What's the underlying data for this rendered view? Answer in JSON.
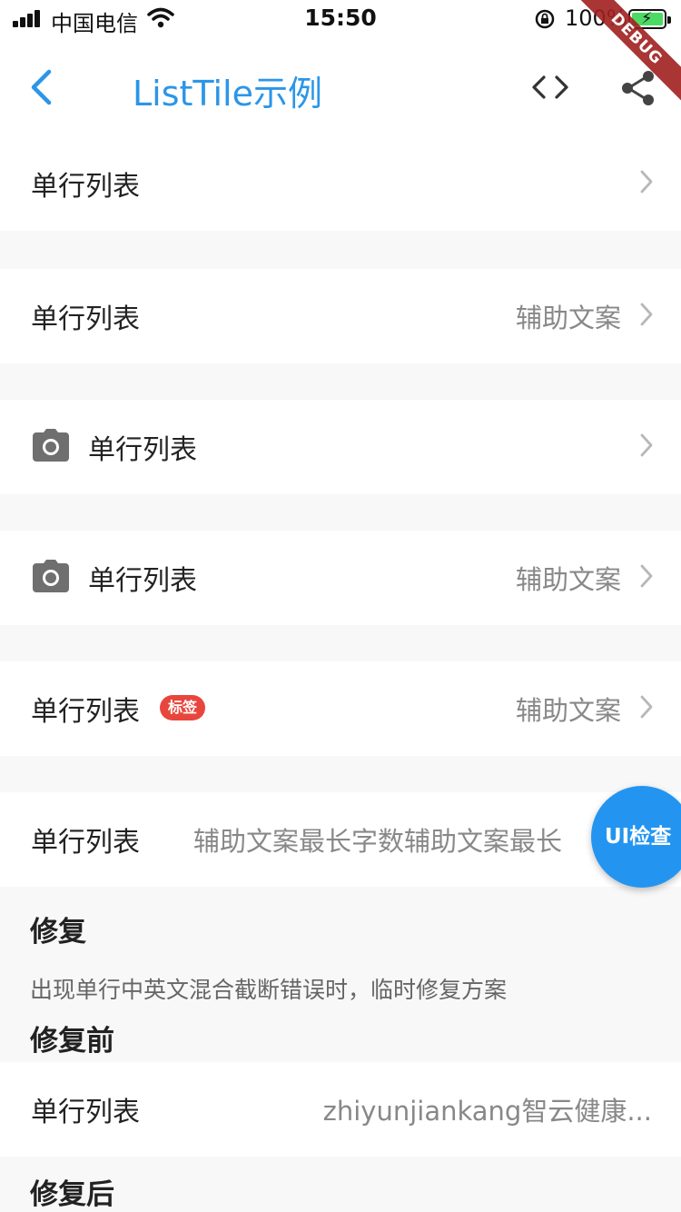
{
  "status_bar": {
    "carrier": "中国电信",
    "time": "15:50",
    "battery_percent": "100%"
  },
  "debug_banner": "DEBUG",
  "nav": {
    "title": "ListTile示例",
    "back_icon": "chevron-left-icon",
    "code_icon": "code-icon",
    "share_icon": "share-icon",
    "accent_color": "#2b96e8"
  },
  "rows": [
    {
      "title": "单行列表",
      "subtitle": "",
      "icon": "",
      "tag": ""
    },
    {
      "title": "单行列表",
      "subtitle": "辅助文案",
      "icon": "",
      "tag": ""
    },
    {
      "title": "单行列表",
      "subtitle": "",
      "icon": "camera-icon",
      "tag": ""
    },
    {
      "title": "单行列表",
      "subtitle": "辅助文案",
      "icon": "camera-icon",
      "tag": ""
    },
    {
      "title": "单行列表",
      "subtitle": "辅助文案",
      "icon": "",
      "tag": "标签"
    },
    {
      "title": "单行列表",
      "subtitle": "辅助文案最长字数辅助文案最长",
      "icon": "",
      "tag": ""
    }
  ],
  "fix_section": {
    "heading": "修复",
    "description": "出现单行中英文混合截断错误时，临时修复方案",
    "before_heading": "修复前",
    "before_row": {
      "title": "单行列表",
      "subtitle": "zhiyunjiankang智云健康..."
    },
    "after_heading": "修复后"
  },
  "fab": {
    "label": "UI检查",
    "color": "#2395f0"
  }
}
